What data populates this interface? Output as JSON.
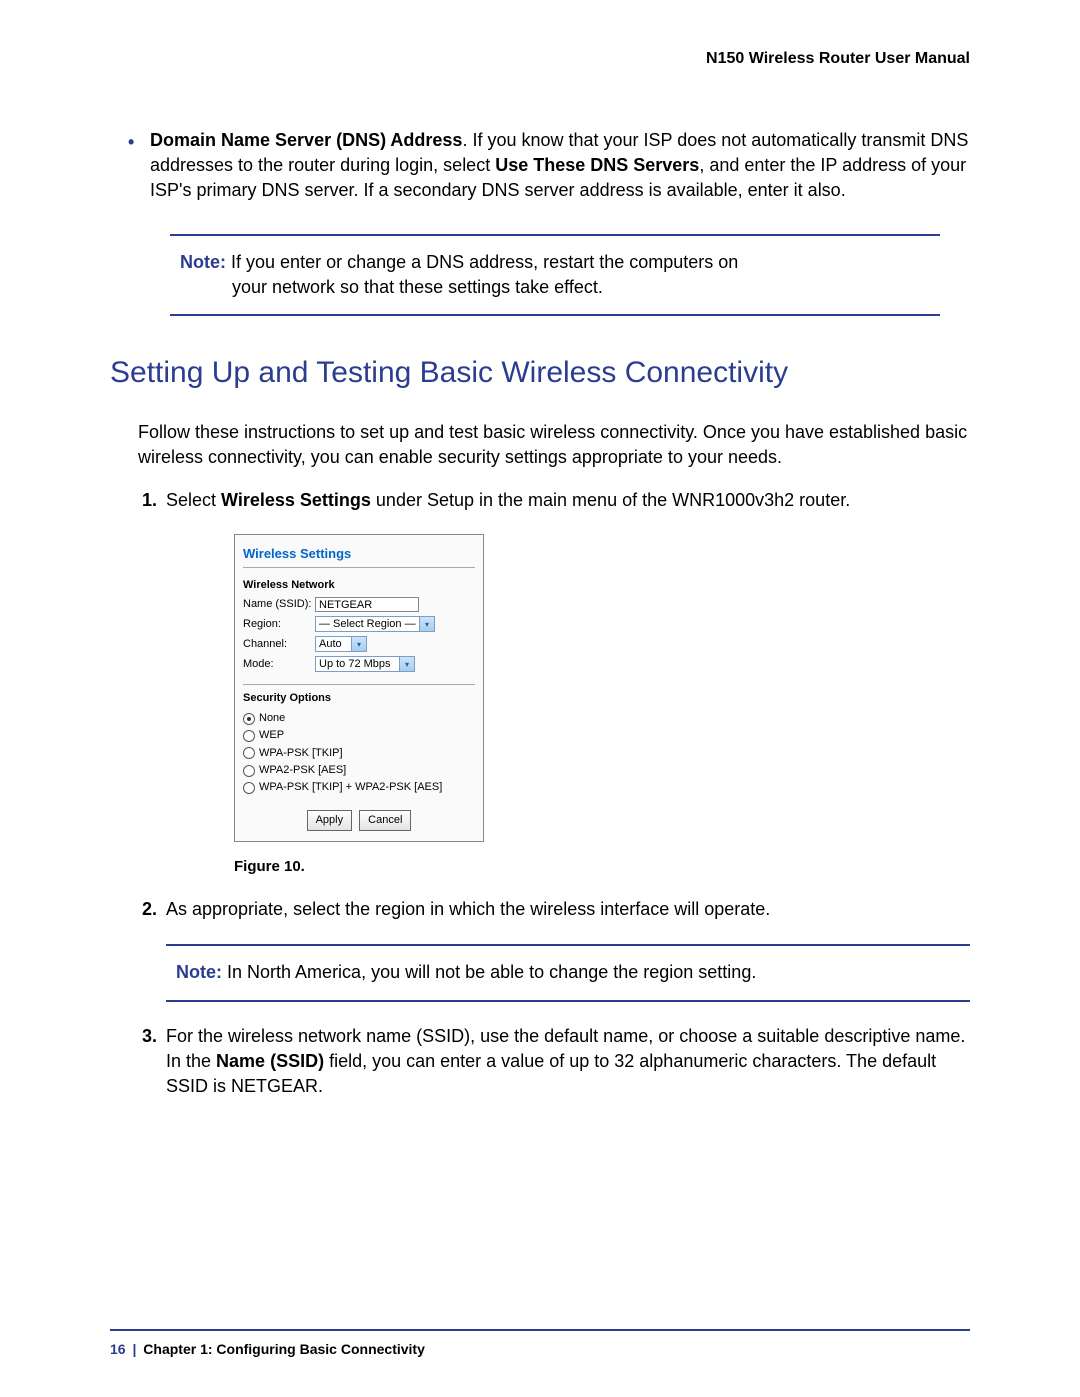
{
  "header": {
    "manual_title": "N150 Wireless Router User Manual"
  },
  "bullet": {
    "bold_lead": "Domain Name Server (DNS) Address",
    "text_after_lead": ". If you know that your ISP does not automatically transmit DNS addresses to the router during login, select ",
    "bold_mid": "Use These DNS Servers",
    "text_tail": ", and enter the IP address of your ISP's primary DNS server. If a secondary DNS server address is available, enter it also."
  },
  "note1": {
    "label": "Note:",
    "line1": "If you enter or change a DNS address, restart the computers on",
    "line2": "your network so that these settings take effect."
  },
  "section_heading": "Setting Up and Testing Basic Wireless Connectivity",
  "intro_para": "Follow these instructions to set up and test basic wireless connectivity. Once you have established basic wireless connectivity, you can enable security settings appropriate to your needs.",
  "step1": {
    "pre": "Select ",
    "bold": "Wireless Settings",
    "post": " under Setup in the main menu of the WNR1000v3h2 router."
  },
  "router": {
    "title": "Wireless Settings",
    "network_section": "Wireless Network",
    "name_label": "Name (SSID):",
    "name_value": "NETGEAR",
    "region_label": "Region:",
    "region_value": "— Select Region —",
    "channel_label": "Channel:",
    "channel_value": "Auto",
    "mode_label": "Mode:",
    "mode_value": "Up to 72 Mbps",
    "security_section": "Security Options",
    "opts": {
      "none": "None",
      "wep": "WEP",
      "wpa_tkip": "WPA-PSK [TKIP]",
      "wpa2_aes": "WPA2-PSK [AES]",
      "wpa_mixed": "WPA-PSK [TKIP] + WPA2-PSK [AES]"
    },
    "apply": "Apply",
    "cancel": "Cancel"
  },
  "figure_caption": "Figure 10.",
  "step2": "As appropriate, select the region in which the wireless interface will operate.",
  "note2": {
    "label": "Note:",
    "text": "In North America, you will not be able to change the region setting."
  },
  "step3": {
    "pre": "For the wireless network name (SSID), use the default name, or choose a suitable descriptive name. In the ",
    "bold": "Name (SSID)",
    "post": " field, you can enter a value of up to 32 alphanumeric characters. The default SSID is NETGEAR."
  },
  "footer": {
    "page": "16",
    "sep": "|",
    "chapter": "Chapter 1:  Configuring Basic Connectivity"
  }
}
